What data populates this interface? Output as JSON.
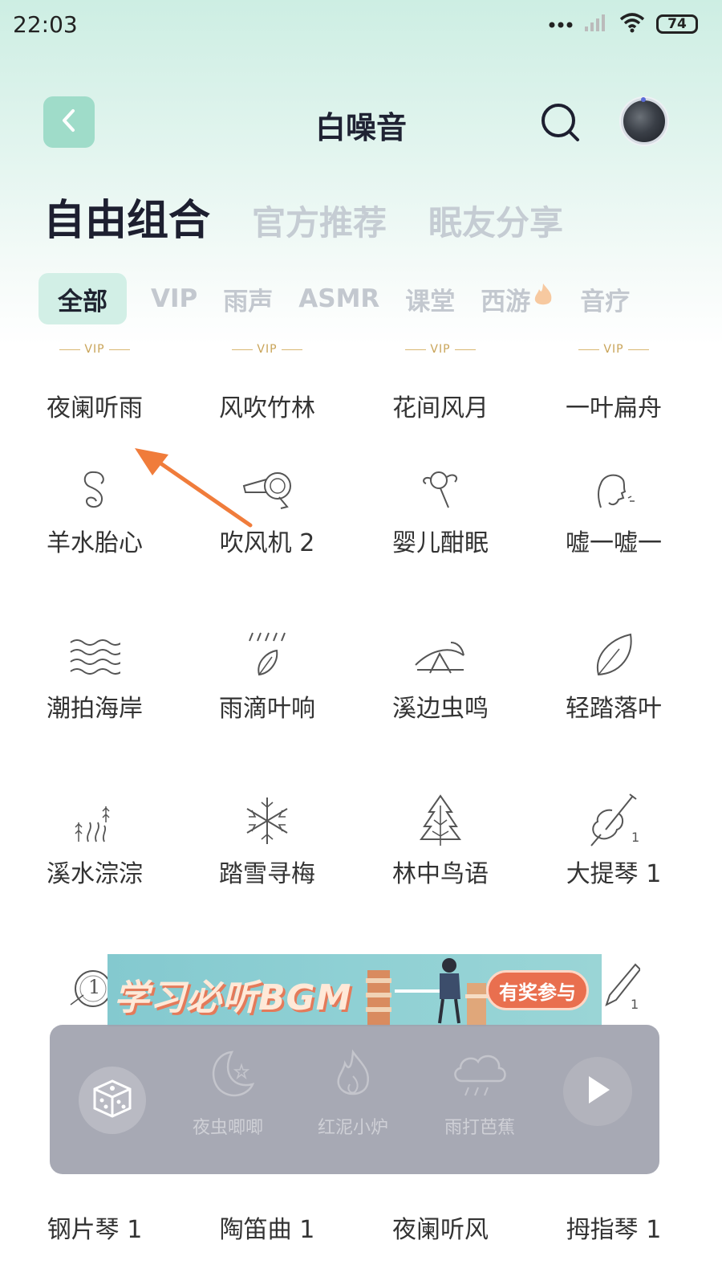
{
  "status": {
    "time": "22:03",
    "battery": "74"
  },
  "header": {
    "title": "白噪音",
    "back_icon": "chevron-left-icon",
    "search_icon": "search-icon"
  },
  "main_tabs": [
    {
      "label": "自由组合",
      "active": true
    },
    {
      "label": "官方推荐",
      "active": false
    },
    {
      "label": "眠友分享",
      "active": false
    }
  ],
  "chips": [
    {
      "label": "全部",
      "active": true
    },
    {
      "label": "VIP"
    },
    {
      "label": "雨声"
    },
    {
      "label": "ASMR"
    },
    {
      "label": "课堂"
    },
    {
      "label": "西游"
    },
    {
      "label": "音疗"
    }
  ],
  "grid": [
    {
      "label": "夜阑听雨",
      "vip": "VIP"
    },
    {
      "label": "风吹竹林",
      "vip": "VIP"
    },
    {
      "label": "花间风月",
      "vip": "VIP"
    },
    {
      "label": "一叶扁舟",
      "vip": "VIP"
    },
    {
      "label": "羊水胎心",
      "icon": "womb-icon"
    },
    {
      "label": "吹风机 2",
      "icon": "hair-dryer-icon"
    },
    {
      "label": "婴儿酣眠",
      "icon": "rattle-icon"
    },
    {
      "label": "嘘一嘘一",
      "icon": "shushing-face-icon"
    },
    {
      "label": "潮拍海岸",
      "icon": "waves-icon"
    },
    {
      "label": "雨滴叶响",
      "icon": "rain-leaf-icon"
    },
    {
      "label": "溪边虫鸣",
      "icon": "grasshopper-icon"
    },
    {
      "label": "轻踏落叶",
      "icon": "leaf-icon"
    },
    {
      "label": "溪水淙淙",
      "icon": "stream-icon"
    },
    {
      "label": "踏雪寻梅",
      "icon": "snowflake-icon"
    },
    {
      "label": "林中鸟语",
      "icon": "pine-tree-icon"
    },
    {
      "label": "大提琴 1",
      "icon": "cello-icon",
      "badge": "1"
    }
  ],
  "partial_badges": [
    "1",
    "1"
  ],
  "banner": {
    "title": "学习必听BGM",
    "button": "有奖参与"
  },
  "player": {
    "dice_icon": "dice-icon",
    "slots": [
      {
        "label": "夜虫唧唧",
        "icon": "moon-icon"
      },
      {
        "label": "红泥小炉",
        "icon": "flame-icon"
      },
      {
        "label": "雨打芭蕉",
        "icon": "rain-cloud-icon"
      }
    ],
    "play_icon": "play-icon"
  },
  "bottom_row": [
    "钢片琴 1",
    "陶笛曲 1",
    "夜阑听风",
    "拇指琴 1"
  ]
}
